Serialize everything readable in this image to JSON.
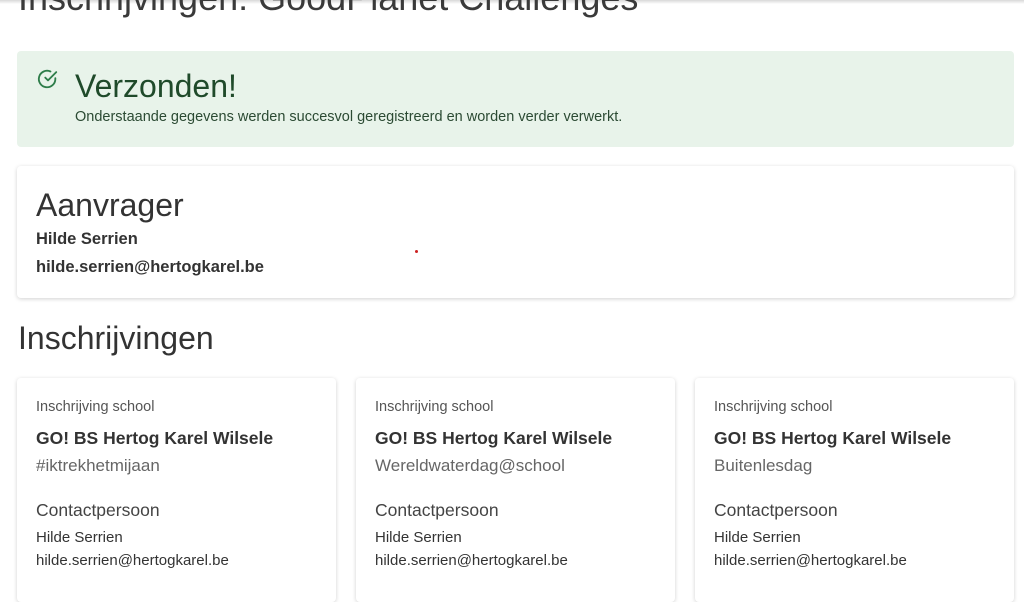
{
  "page": {
    "title": "Inschrijvingen: GoodPlanet Challenges"
  },
  "success": {
    "icon": "check-circle-icon",
    "title": "Verzonden!",
    "message": "Onderstaande gegevens werden succesvol geregistreerd en worden verder verwerkt."
  },
  "aanvrager": {
    "heading": "Aanvrager",
    "name": "Hilde Serrien",
    "email": "hilde.serrien@hertogkarel.be"
  },
  "inschrijvingen": {
    "heading": "Inschrijvingen",
    "cards": [
      {
        "type": "Inschrijving school",
        "school": "GO! BS Hertog Karel Wilsele",
        "challenge": "#iktrekhetmijaan",
        "contact_heading": "Contactpersoon",
        "contact_name": "Hilde Serrien",
        "contact_email": "hilde.serrien@hertogkarel.be"
      },
      {
        "type": "Inschrijving school",
        "school": "GO! BS Hertog Karel Wilsele",
        "challenge": "Wereldwaterdag@school",
        "contact_heading": "Contactpersoon",
        "contact_name": "Hilde Serrien",
        "contact_email": "hilde.serrien@hertogkarel.be"
      },
      {
        "type": "Inschrijving school",
        "school": "GO! BS Hertog Karel Wilsele",
        "challenge": "Buitenlesdag",
        "contact_heading": "Contactpersoon",
        "contact_name": "Hilde Serrien",
        "contact_email": "hilde.serrien@hertogkarel.be"
      }
    ]
  },
  "colors": {
    "success_bg": "#e8f3ea",
    "success_text": "#1f4a2a",
    "success_icon": "#2e7d4a"
  }
}
